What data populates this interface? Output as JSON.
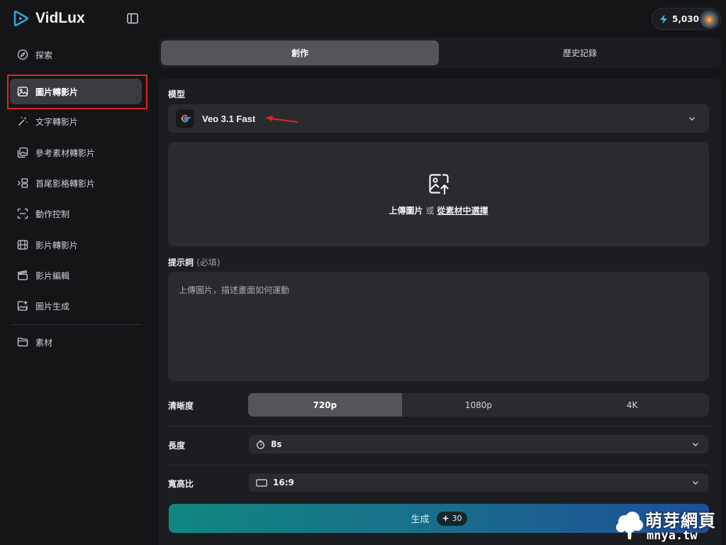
{
  "brand": {
    "name": "VidLux"
  },
  "header": {
    "credits": "5,030"
  },
  "sidebar": {
    "items": [
      {
        "label": "探索",
        "icon": "compass-icon"
      },
      {
        "label": "圖片轉影片",
        "icon": "image-icon",
        "active": true
      },
      {
        "label": "文字轉影片",
        "icon": "magic-wand-icon"
      },
      {
        "label": "參考素材轉影片",
        "icon": "images-icon"
      },
      {
        "label": "首尾影格轉影片",
        "icon": "frames-icon"
      },
      {
        "label": "動作控制",
        "icon": "scan-icon"
      },
      {
        "label": "影片轉影片",
        "icon": "film-icon"
      },
      {
        "label": "影片編輯",
        "icon": "clapper-icon"
      },
      {
        "label": "圖片生成",
        "icon": "image-plus-icon"
      },
      {
        "label": "素材",
        "icon": "folder-icon"
      }
    ]
  },
  "tabs": {
    "create": "創作",
    "history": "歷史記錄"
  },
  "form": {
    "model_label": "模型",
    "model_value": "Veo 3.1 Fast",
    "upload_primary": "上傳圖片",
    "upload_or": "或",
    "upload_link": "從素材中選擇",
    "prompt_label": "提示詞",
    "prompt_required": "(必填)",
    "prompt_placeholder": "上傳圖片，描述畫面如何運動",
    "resolution_label": "清晰度",
    "resolution_options": [
      "720p",
      "1080p",
      "4K"
    ],
    "resolution_selected": "720p",
    "duration_label": "長度",
    "duration_value": "8s",
    "aspect_label": "寬高比",
    "aspect_value": "16:9",
    "generate_label": "生成",
    "generate_cost": "30"
  },
  "watermark": {
    "title": "萌芽網頁",
    "sub": "mnya.tw"
  },
  "colors": {
    "accent_start": "#11877f",
    "accent_end": "#1d4f9a",
    "highlight": "#e12424",
    "brand": "#2fa6d8"
  }
}
